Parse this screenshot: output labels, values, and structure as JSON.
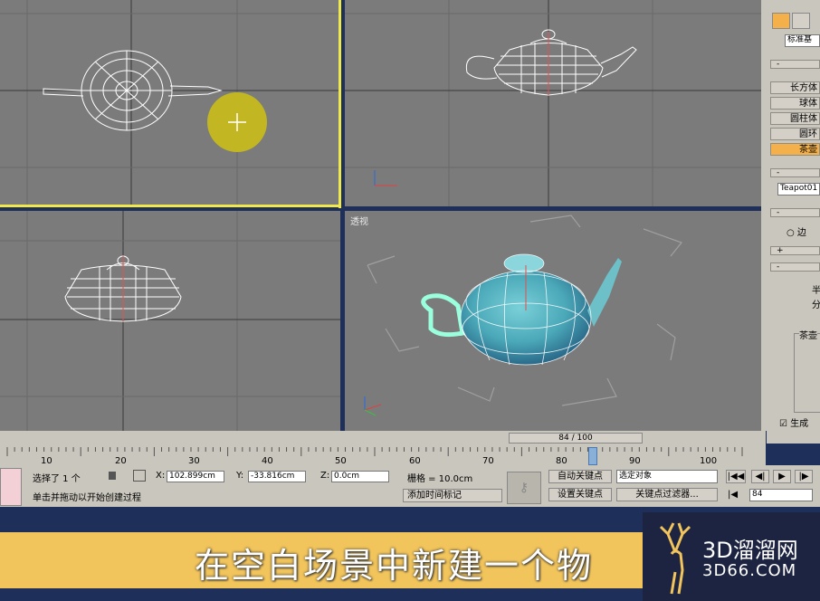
{
  "viewports": {
    "perspective_label": "透视"
  },
  "command_panel": {
    "category": "标准基",
    "buttons": [
      "长方体",
      "球体",
      "圆柱体",
      "圆环",
      "茶壶"
    ],
    "selected_button": "茶壶",
    "object_name": "Teapot01",
    "radio_label": "边",
    "section_label": "茶壶",
    "side_labels": [
      "半",
      "分"
    ],
    "checkbox_label": "生成"
  },
  "timeline": {
    "frame": "84 / 100",
    "ticks": [
      "10",
      "20",
      "30",
      "40",
      "50",
      "60",
      "70",
      "80",
      "90",
      "100"
    ]
  },
  "status_bar": {
    "selection": "选择了 1 个",
    "x_label": "X:",
    "x_value": "102.899cm",
    "y_label": "Y:",
    "y_value": "-33.816cm",
    "z_label": "Z:",
    "z_value": "0.0cm",
    "grid": "栅格 = 10.0cm",
    "prompt": "单击并拖动以开始创建过程",
    "add_time_tag": "添加时间标记",
    "auto_key": "自动关键点",
    "set_key": "设置关键点",
    "selected_object": "选定对象",
    "key_filters": "关键点过滤器...",
    "current_frame": "84"
  },
  "caption": "在空白场景中新建一个物",
  "logo": {
    "brand": "3D溜溜网",
    "domain": "3D66.COM"
  },
  "colors": {
    "viewport_bg": "#7b7b7b",
    "active_border": "#f0e84a",
    "highlight": "#f4b04a",
    "caption_bar": "#f2c55c"
  }
}
